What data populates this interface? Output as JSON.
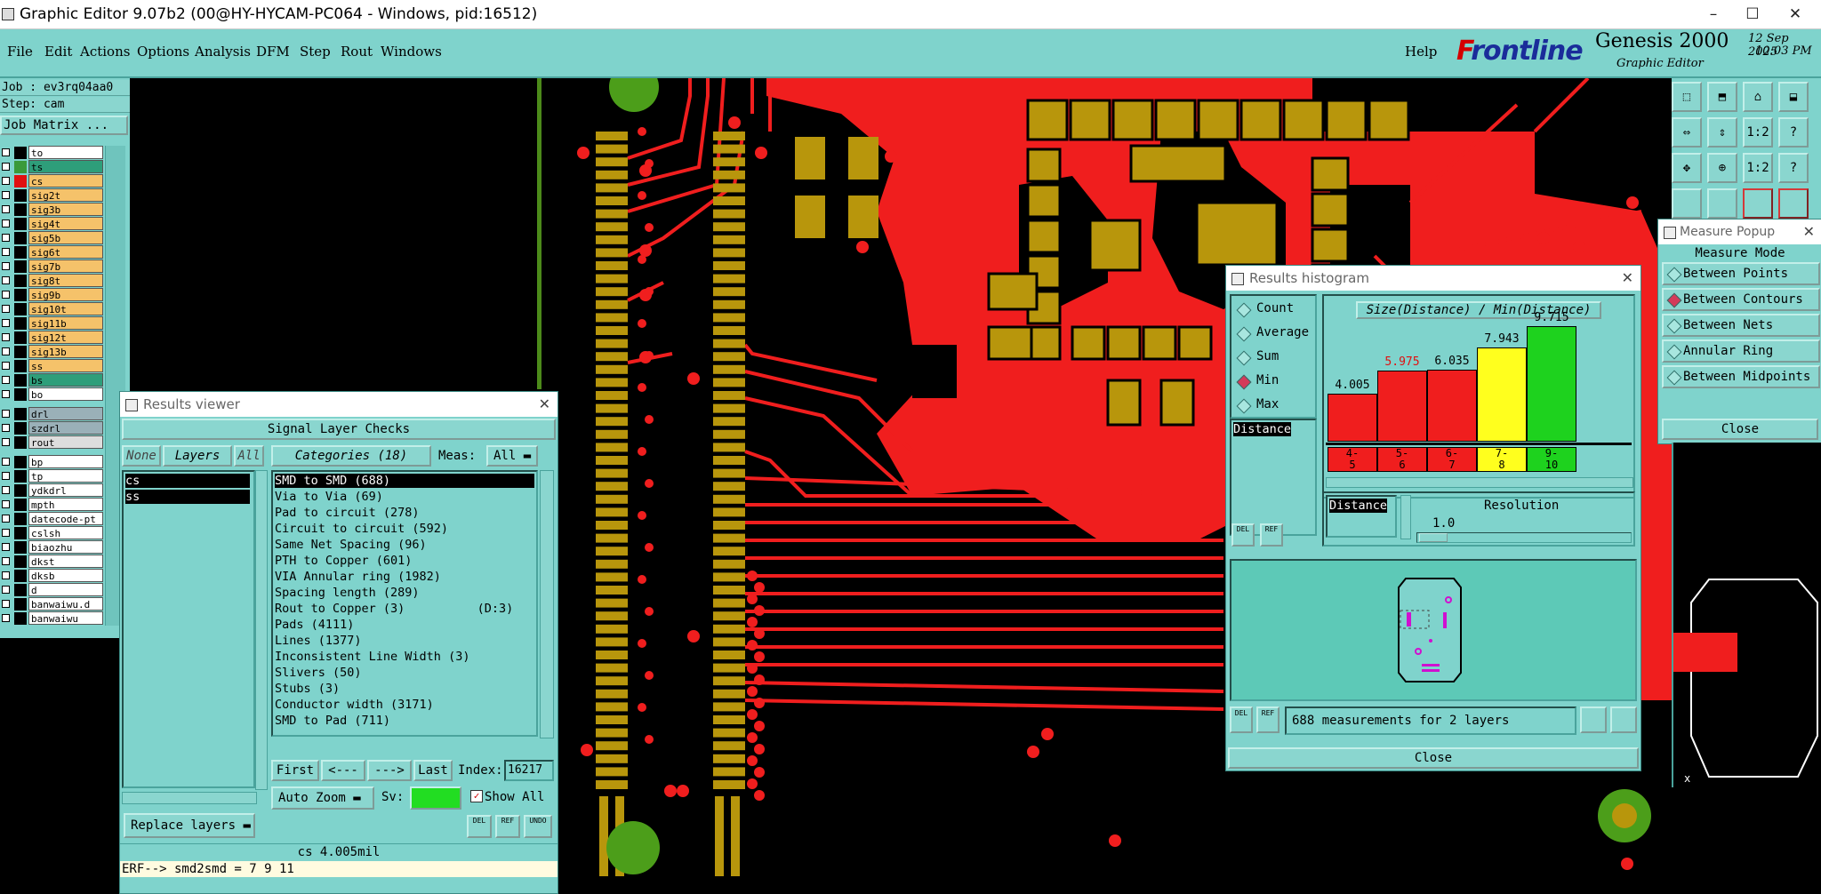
{
  "window": {
    "title": "Graphic Editor 9.07b2 (00@HY-HYCAM-PC064 - Windows, pid:16512)",
    "minimize": "–",
    "maximize": "☐",
    "close": "✕"
  },
  "menu": {
    "items": [
      "File",
      "Edit",
      "Actions",
      "Options",
      "Analysis",
      "DFM",
      "Step",
      "Rout",
      "Windows"
    ],
    "help": "Help"
  },
  "brand": {
    "logo_f": "F",
    "logo_rest": "rontline",
    "product": "Genesis 2000",
    "subtitle": "Graphic Editor",
    "date": "12 Sep 2025",
    "time": "10:03 PM"
  },
  "left": {
    "job": "Job : ev3rq04aa0",
    "step": "Step: cam",
    "job_matrix": "Job Matrix ...",
    "layers": [
      {
        "name": "to",
        "color": "#ffffff",
        "swatch": "#000000"
      },
      {
        "name": "ts",
        "color": "#2e9e7a",
        "swatch": "#3a9a3a"
      },
      {
        "name": "cs",
        "color": "#f5c26a",
        "swatch": "#e01010"
      },
      {
        "name": "sig2t",
        "color": "#f5c26a",
        "swatch": "#000000"
      },
      {
        "name": "sig3b",
        "color": "#f5c26a",
        "swatch": "#000000"
      },
      {
        "name": "sig4t",
        "color": "#f5c26a",
        "swatch": "#000000"
      },
      {
        "name": "sig5b",
        "color": "#f5c26a",
        "swatch": "#000000"
      },
      {
        "name": "sig6t",
        "color": "#f5c26a",
        "swatch": "#000000"
      },
      {
        "name": "sig7b",
        "color": "#f5c26a",
        "swatch": "#000000"
      },
      {
        "name": "sig8t",
        "color": "#f5c26a",
        "swatch": "#000000"
      },
      {
        "name": "sig9b",
        "color": "#f5c26a",
        "swatch": "#000000"
      },
      {
        "name": "sig10t",
        "color": "#f5c26a",
        "swatch": "#000000"
      },
      {
        "name": "sig11b",
        "color": "#f5c26a",
        "swatch": "#000000"
      },
      {
        "name": "sig12t",
        "color": "#f5c26a",
        "swatch": "#000000"
      },
      {
        "name": "sig13b",
        "color": "#f5c26a",
        "swatch": "#000000"
      },
      {
        "name": "ss",
        "color": "#f5c26a",
        "swatch": "#000000"
      },
      {
        "name": "bs",
        "color": "#2e9e7a",
        "swatch": "#000000"
      },
      {
        "name": "bo",
        "color": "#ffffff",
        "swatch": "#000000"
      },
      {
        "name": "drl",
        "color": "#9ab0b8",
        "swatch": "#000000"
      },
      {
        "name": "szdrl",
        "color": "#9ab0b8",
        "swatch": "#000000"
      },
      {
        "name": "rout",
        "color": "#dddddd",
        "swatch": "#000000"
      },
      {
        "name": "bp",
        "color": "#ffffff",
        "swatch": "#000000"
      },
      {
        "name": "tp",
        "color": "#ffffff",
        "swatch": "#000000"
      },
      {
        "name": "ydkdrl",
        "color": "#ffffff",
        "swatch": "#000000"
      },
      {
        "name": "mpth",
        "color": "#ffffff",
        "swatch": "#000000"
      },
      {
        "name": "datecode-pt",
        "color": "#ffffff",
        "swatch": "#000000"
      },
      {
        "name": "cslsh",
        "color": "#ffffff",
        "swatch": "#000000"
      },
      {
        "name": "biaozhu",
        "color": "#ffffff",
        "swatch": "#000000"
      },
      {
        "name": "dkst",
        "color": "#ffffff",
        "swatch": "#000000"
      },
      {
        "name": "dksb",
        "color": "#ffffff",
        "swatch": "#000000"
      },
      {
        "name": "d",
        "color": "#ffffff",
        "swatch": "#000000"
      },
      {
        "name": "banwaiwu.d",
        "color": "#ffffff",
        "swatch": "#000000"
      },
      {
        "name": "banwaiwu",
        "color": "#ffffff",
        "swatch": "#000000"
      }
    ]
  },
  "results_viewer": {
    "title": "Results viewer",
    "header": "Signal Layer Checks",
    "none": "None",
    "layers_label": "Layers",
    "all": "All",
    "categories": "Categories (18)",
    "meas_label": "Meas:",
    "meas_value": "All",
    "layer_list": [
      "cs",
      "ss"
    ],
    "category_list": [
      "SMD to SMD (688)",
      "Via to Via (69)",
      "Pad to circuit (278)",
      "Circuit to circuit (592)",
      "Same Net Spacing (96)",
      "PTH to Copper (601)",
      "VIA Annular ring (1982)",
      "Spacing length (289)",
      "Rout to Copper (3)          (D:3)",
      "Pads (4111)",
      "Lines (1377)",
      "Inconsistent Line Width (3)",
      "Slivers (50)",
      "Stubs (3)",
      "Conductor width (3171)",
      "SMD to Pad (711)"
    ],
    "first": "First",
    "prev": "<---",
    "next": "--->",
    "last": "Last",
    "index_label": "Index:",
    "index_value": "16217",
    "auto_zoom": "Auto Zoom",
    "sv_label": "Sv:",
    "show_all": "Show All",
    "replace_layers": "Replace layers",
    "status": "cs 4.005mil",
    "erf": "ERF--> smd2smd = 7 9 11",
    "icon_del": "DEL",
    "icon_ref": "REF",
    "icon_undo": "UNDO"
  },
  "histogram": {
    "title": "Results histogram",
    "modes": [
      {
        "label": "Count",
        "on": false
      },
      {
        "label": "Average",
        "on": false
      },
      {
        "label": "Sum",
        "on": false
      },
      {
        "label": "Min",
        "on": true
      },
      {
        "label": "Max",
        "on": false
      }
    ],
    "distance_list": "Distance",
    "distance_field": "Distance",
    "resolution_label": "Resolution",
    "resolution_value": "1.0",
    "summary": "688 measurements for 2 layers",
    "close": "Close",
    "icon_del": "DEL",
    "icon_ref": "REF"
  },
  "chart_data": {
    "type": "bar",
    "title": "Size(Distance) / Min(Distance)",
    "categories": [
      "4-\n5",
      "5-\n6",
      "6-\n7",
      "7-\n8",
      "9-\n10"
    ],
    "values": [
      4.005,
      5.975,
      6.035,
      7.943,
      9.715
    ],
    "value_labels": [
      "4.005",
      "5.975",
      "6.035",
      "7.943",
      "9.715"
    ],
    "bar_colors": [
      "#f01e1e",
      "#f01e1e",
      "#f01e1e",
      "#ffff1e",
      "#1ed21e"
    ],
    "label_colors": [
      "#000000",
      "#e01010",
      "#000000",
      "#000000",
      "#000000"
    ]
  },
  "measure": {
    "title": "Measure Popup",
    "mode_label": "Measure Mode",
    "modes": [
      {
        "label": "Between Points",
        "on": false
      },
      {
        "label": "Between Contours",
        "on": true
      },
      {
        "label": "Between Nets",
        "on": false
      },
      {
        "label": "Annular Ring",
        "on": false
      },
      {
        "label": "Between Midpoints",
        "on": false
      }
    ],
    "close": "Close"
  },
  "toolbar_icons": [
    "⬚",
    "⬒",
    "⌂",
    "⬓",
    "⇔",
    "⇕",
    "1:2",
    "?",
    "✥",
    "⊕",
    "1:2",
    "?"
  ],
  "colors": {
    "teal": "#7fd3cc",
    "copper": "#f01e1e",
    "pad": "#b8960c",
    "green": "#4c9e1a"
  }
}
